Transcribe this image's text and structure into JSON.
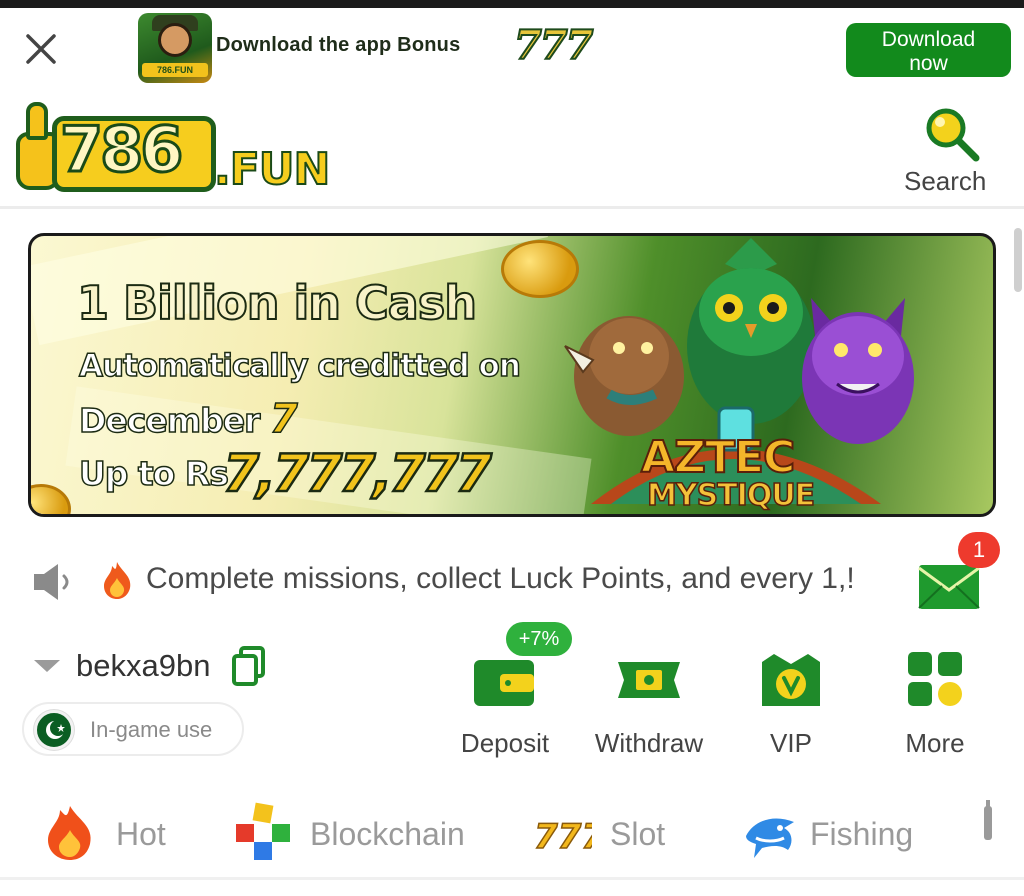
{
  "app_banner": {
    "text": "Download the app Bonus",
    "bonus": "777",
    "icon_tag": "786.FUN",
    "download_label_line1": "Download",
    "download_label_line2": "now"
  },
  "header": {
    "logo_number": "786",
    "logo_suffix": ".FUN",
    "search_label": "Search"
  },
  "hero": {
    "title": "1 Billion in Cash",
    "line1": "Automatically creditted on",
    "line2_prefix": "December",
    "line2_day": "7",
    "line3_prefix": "Up to Rs",
    "amount": "7,777,777",
    "game_title": "AZTEC",
    "game_subtitle": "MYSTIQUE"
  },
  "notice": {
    "text": "Complete missions, collect Luck Points, and every 1,!",
    "mail_badge": "1"
  },
  "account": {
    "username": "bekxa9bn",
    "ingame_label": "In-game use",
    "actions": [
      {
        "label": "Deposit",
        "icon": "wallet-icon"
      },
      {
        "label": "Withdraw",
        "icon": "cash-icon"
      },
      {
        "label": "VIP",
        "icon": "vip-badge-icon"
      },
      {
        "label": "More",
        "icon": "grid-icon"
      }
    ],
    "deposit_badge": "+7%"
  },
  "tabs": [
    {
      "label": "Hot",
      "icon": "fire-icon"
    },
    {
      "label": "Blockchain",
      "icon": "blocks-icon"
    },
    {
      "label": "Slot",
      "icon": "slot-777-icon"
    },
    {
      "label": "Fishing",
      "icon": "shark-icon"
    }
  ],
  "colors": {
    "brand_green": "#128a1c",
    "brand_yellow": "#f6cd1e",
    "badge_red": "#ee3a2d",
    "text_gray": "#9a9a9a"
  }
}
